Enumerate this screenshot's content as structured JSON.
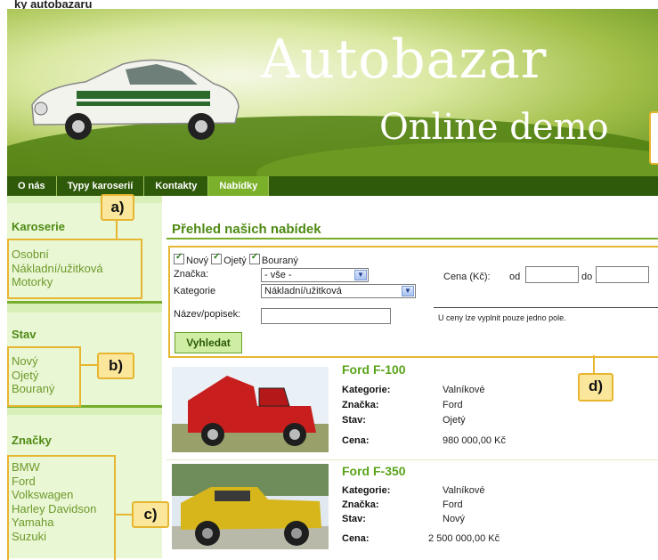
{
  "caption": "ky autobazaru",
  "header": {
    "title": "Autobazar",
    "subtitle": "Online demo"
  },
  "nav": {
    "items": [
      "O nás",
      "Typy karoserií",
      "Kontakty",
      "Nabídky"
    ]
  },
  "sidebar": {
    "karoserie": {
      "title": "Karoserie",
      "items": [
        "Osobní",
        "Nákladní/užitková",
        "Motorky"
      ]
    },
    "stav": {
      "title": "Stav",
      "items": [
        "Nový",
        "Ojetý",
        "Bouraný"
      ]
    },
    "znacky": {
      "title": "Značky",
      "items": [
        "BMW",
        "Ford",
        "Volkswagen",
        "Harley Davidson",
        "Yamaha",
        "Suzuki"
      ]
    }
  },
  "labels": {
    "a": "a)",
    "b": "b)",
    "c": "c)",
    "d": "d)"
  },
  "main": {
    "title": "Přehled našich nabídek"
  },
  "form": {
    "checkboxes": [
      "Nový",
      "Ojetý",
      "Bouraný"
    ],
    "znacka_label": "Značka:",
    "znacka_value": "- vše -",
    "kategorie_label": "Kategorie",
    "kategorie_value": "Nákladní/užitková",
    "nazev_label": "Název/popisek:",
    "nazev_value": "",
    "cena_label": "Cena (Kč):",
    "od_label": "od",
    "do_label": "do",
    "od_value": "",
    "do_value": "",
    "hint": "U ceny lze vyplnit pouze jedno pole.",
    "submit": "Vyhledat"
  },
  "offers": [
    {
      "name": "Ford F-100",
      "kategorie_label": "Kategorie:",
      "kategorie": "Valníkové",
      "znacka_label": "Značka:",
      "znacka": "Ford",
      "stav_label": "Stav:",
      "stav": "Ojetý",
      "cena_label": "Cena:",
      "cena": "980 000,00 Kč"
    },
    {
      "name": "Ford F-350",
      "kategorie_label": "Kategorie:",
      "kategorie": "Valníkové",
      "znacka_label": "Značka:",
      "znacka": "Ford",
      "stav_label": "Stav:",
      "stav": "Nový",
      "cena_label": "Cena:",
      "cena": "2 500 000,00 Kč"
    }
  ],
  "colors": {
    "accent_green": "#4f8a14",
    "nav_bg": "#2f5a09",
    "highlight": "#e7b630"
  }
}
